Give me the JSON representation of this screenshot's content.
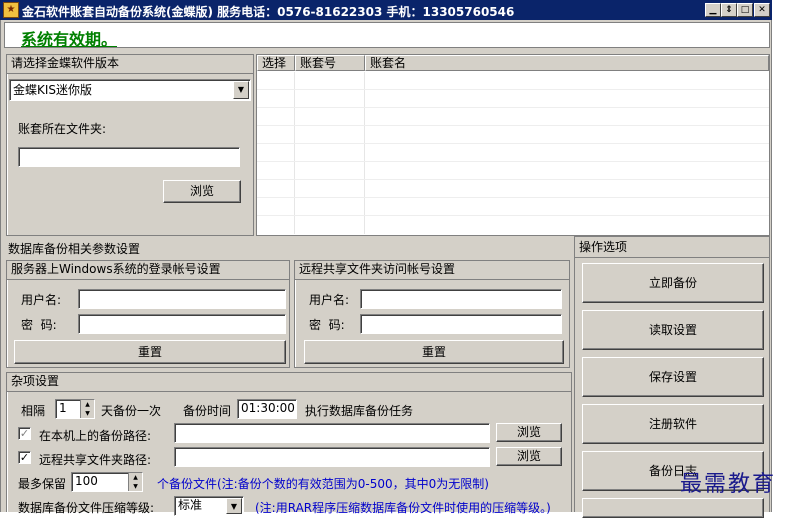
{
  "window": {
    "title": "金石软件账套自动备份系统(金蝶版)   服务电话：0576-81622303  手机：13305760546",
    "controls": [
      "minimize-icon",
      "restore-icon",
      "close-icon"
    ]
  },
  "banner": {
    "status": "系统有效期。"
  },
  "version_panel": {
    "header": "请选择金蝶软件版本",
    "selected": "金蝶KIS迷你版",
    "folder_label": "账套所在文件夹:",
    "folder_value": "",
    "browse_label": "浏览"
  },
  "account_grid": {
    "columns": [
      "选择",
      "账套号",
      "账套名"
    ],
    "rows": []
  },
  "db_params": {
    "header": "数据库备份相关参数设置",
    "server": {
      "header": "服务器上Windows系统的登录帐号设置",
      "user_label": "用户名:",
      "user_value": "",
      "pass_label": "密  码:",
      "pass_value": "",
      "reset_label": "重置"
    },
    "remote": {
      "header": "远程共享文件夹访问帐号设置",
      "user_label": "用户名:",
      "user_value": "",
      "pass_label": "密  码:",
      "pass_value": "",
      "reset_label": "重置"
    }
  },
  "misc": {
    "header": "杂项设置",
    "interval_prefix": "相隔",
    "interval_value": "1",
    "interval_suffix": "天备份一次",
    "time_label": "备份时间",
    "time_value": "01:30:00",
    "task_label": "执行数据库备份任务",
    "local_path_label": "在本机上的备份路径:",
    "local_path_checked": true,
    "local_path_value": "",
    "remote_path_label": "远程共享文件夹路径:",
    "remote_path_checked": true,
    "remote_path_value": "",
    "browse_label": "浏览",
    "keep_label": "最多保留",
    "keep_value": "100",
    "keep_note": "个备份文件(注:备份个数的有效范围为0-500，其中0为无限制)",
    "compress_label": "数据库备份文件压缩等级:",
    "compress_value": "标准",
    "compress_note": "(注:用RAR程序压缩数据库备份文件时使用的压缩等级。)"
  },
  "operations": {
    "header": "操作选项",
    "buttons": [
      "立即备份",
      "读取设置",
      "保存设置",
      "注册软件",
      "备份日志"
    ]
  },
  "watermark": "最需教育"
}
